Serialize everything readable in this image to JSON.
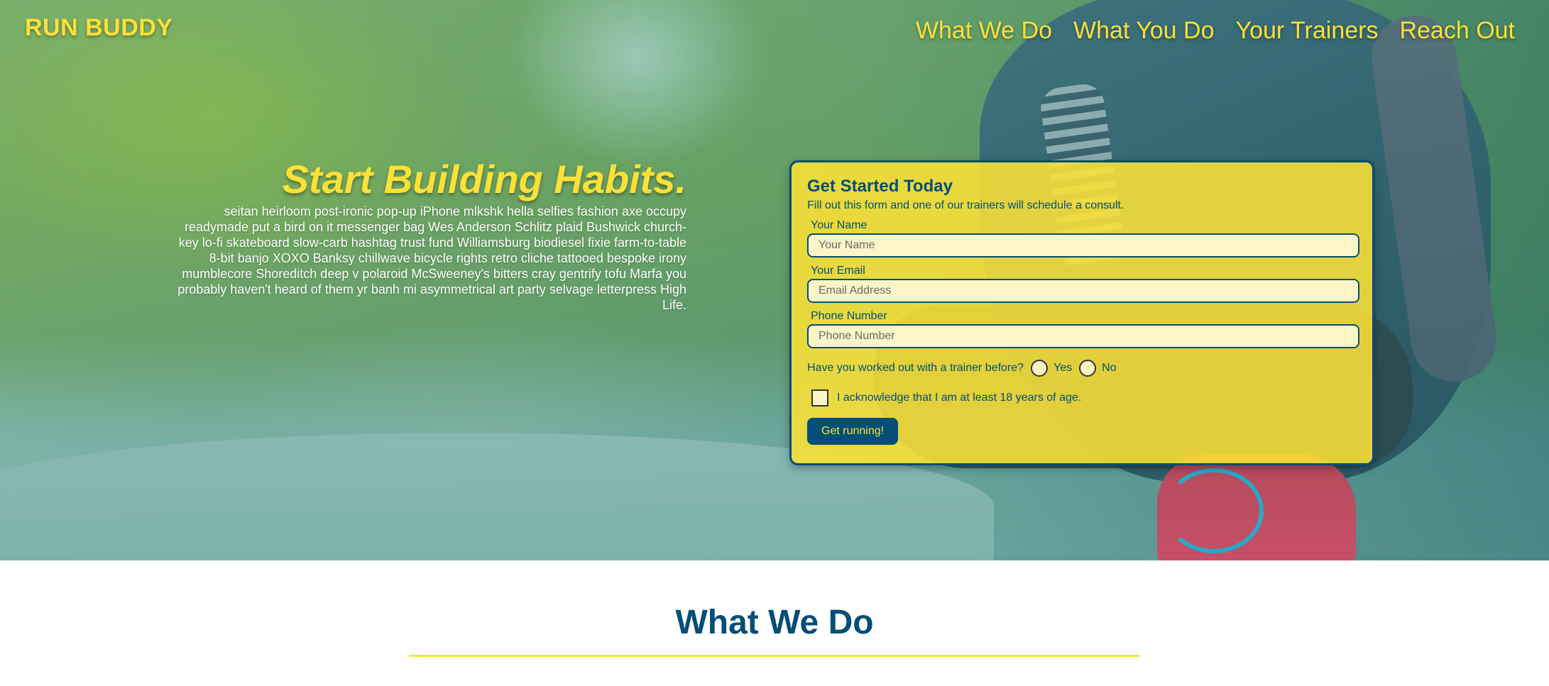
{
  "header": {
    "brand": "RUN BUDDY",
    "nav": [
      {
        "label": "What We Do"
      },
      {
        "label": "What You Do"
      },
      {
        "label": "Your Trainers"
      },
      {
        "label": "Reach Out"
      }
    ]
  },
  "hero": {
    "title": "Start Building Habits.",
    "body": "seitan heirloom post-ironic pop-up iPhone mlkshk hella selfies fashion axe occupy readymade put a bird on it messenger bag Wes Anderson Schlitz plaid Bushwick church-key lo-fi skateboard slow-carb hashtag trust fund Williamsburg biodiesel fixie farm-to-table 8-bit banjo XOXO Banksy chillwave bicycle rights retro cliche tattooed bespoke irony mumblecore Shoreditch deep v polaroid McSweeney's bitters cray gentrify tofu Marfa you probably haven't heard of them yr banh mi asymmetrical art party selvage letterpress High Life."
  },
  "form": {
    "title": "Get Started Today",
    "subtitle": "Fill out this form and one of our trainers will schedule a consult.",
    "name_label": "Your Name",
    "name_placeholder": "Your Name",
    "email_label": "Your Email",
    "email_placeholder": "Email Address",
    "phone_label": "Phone Number",
    "phone_placeholder": "Phone Number",
    "trainer_question": "Have you worked out with a trainer before?",
    "yes_label": "Yes",
    "no_label": "No",
    "age_ack": "I acknowledge that I am at least 18 years of age.",
    "submit_label": "Get running!"
  },
  "what_we_do": {
    "title": "What We Do"
  },
  "colors": {
    "accent": "#fce138",
    "primary": "#024e76"
  }
}
